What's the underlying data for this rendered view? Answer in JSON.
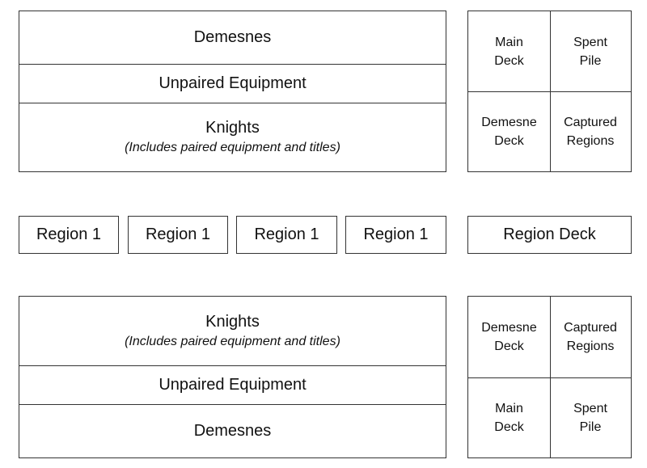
{
  "player_top": {
    "play_area": {
      "rows": [
        {
          "title": "Demesnes"
        },
        {
          "title": "Unpaired Equipment"
        },
        {
          "title": "Knights",
          "subtitle": "(Includes paired equipment and titles)"
        }
      ]
    },
    "decks": [
      {
        "line1": "Main",
        "line2": "Deck"
      },
      {
        "line1": "Spent",
        "line2": "Pile"
      },
      {
        "line1": "Demesne",
        "line2": "Deck"
      },
      {
        "line1": "Captured",
        "line2": "Regions"
      }
    ]
  },
  "center": {
    "regions": [
      "Region 1",
      "Region 1",
      "Region 1",
      "Region 1"
    ],
    "region_deck": "Region Deck"
  },
  "player_bottom": {
    "play_area": {
      "rows": [
        {
          "title": "Knights",
          "subtitle": "(Includes paired equipment and titles)"
        },
        {
          "title": "Unpaired Equipment"
        },
        {
          "title": "Demesnes"
        }
      ]
    },
    "decks": [
      {
        "line1": "Demesne",
        "line2": "Deck"
      },
      {
        "line1": "Captured",
        "line2": "Regions"
      },
      {
        "line1": "Main",
        "line2": "Deck"
      },
      {
        "line1": "Spent",
        "line2": "Pile"
      }
    ]
  }
}
